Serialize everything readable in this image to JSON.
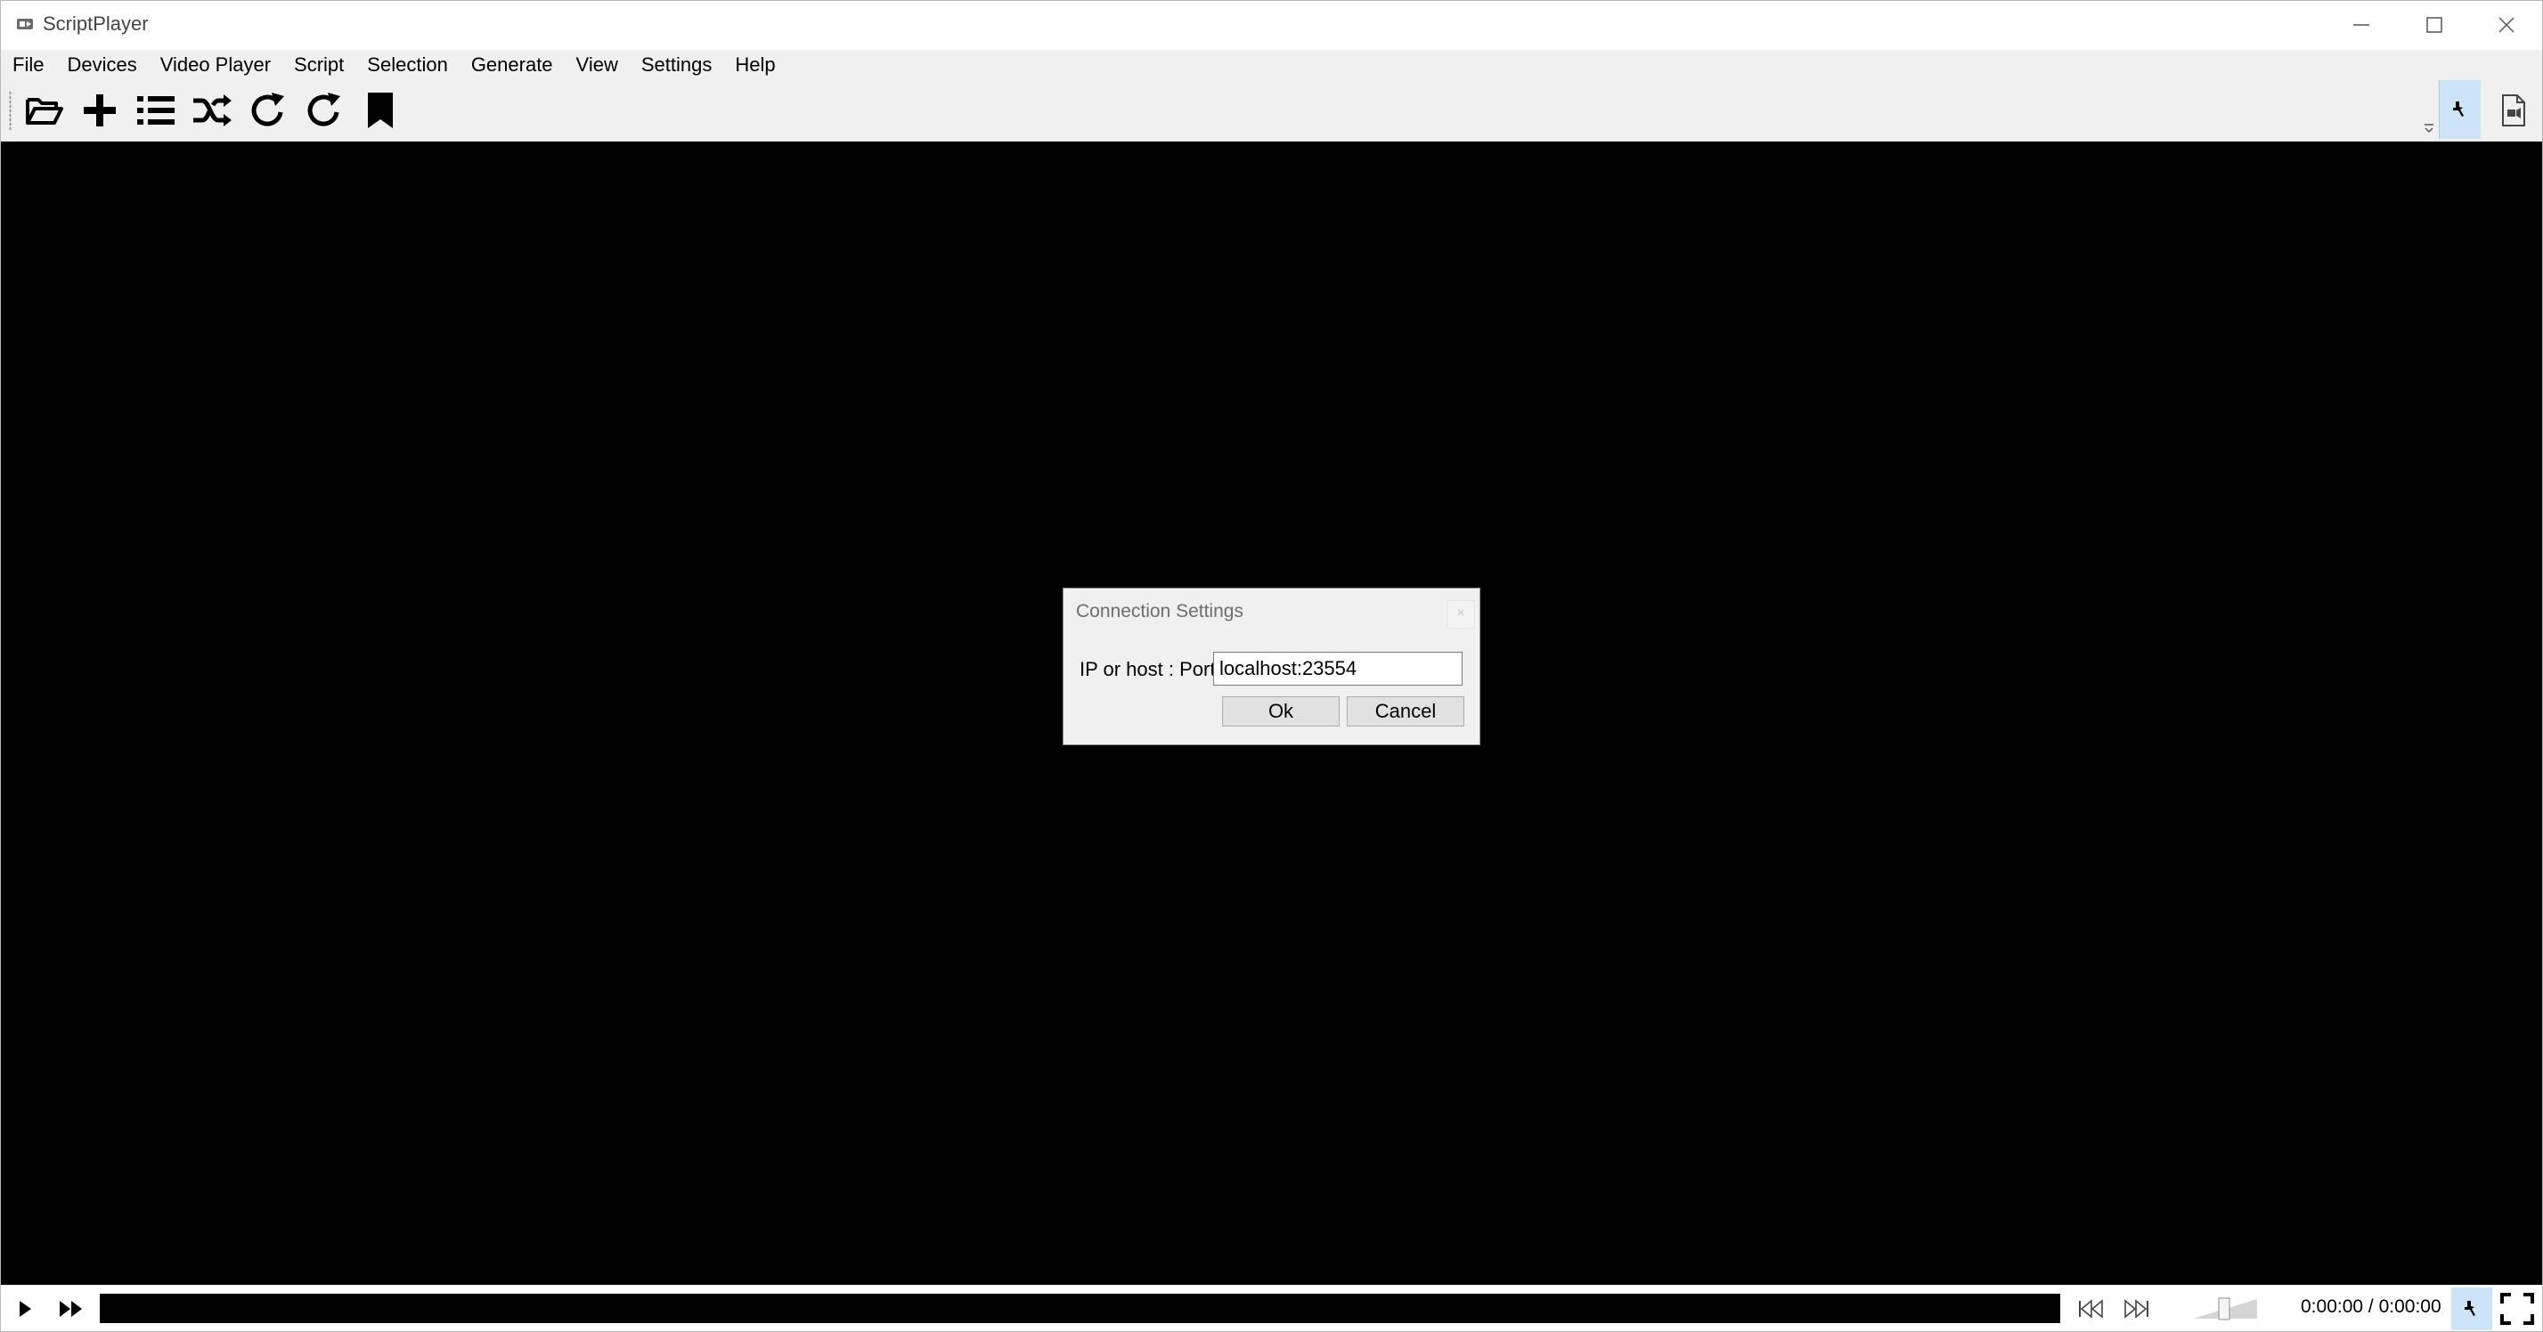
{
  "window": {
    "title": "ScriptPlayer"
  },
  "menu": {
    "items": [
      "File",
      "Devices",
      "Video Player",
      "Script",
      "Selection",
      "Generate",
      "View",
      "Settings",
      "Help"
    ]
  },
  "toolbar": {
    "icons": [
      "folder-open-icon",
      "add-icon",
      "playlist-icon",
      "shuffle-icon",
      "repeat-icon",
      "repeat-single-icon",
      "bookmark-icon"
    ],
    "right_icons": [
      "connect-plug-icon",
      "file-icon"
    ]
  },
  "dialog": {
    "title": "Connection Settings",
    "close_glyph": "×",
    "label": "IP or host : Port",
    "input_value": "localhost:23554",
    "ok_label": "Ok",
    "cancel_label": "Cancel"
  },
  "player": {
    "time": "0:00:00 / 0:00:00",
    "icons": [
      "play-icon",
      "fast-forward-icon",
      "skip-previous-icon",
      "skip-next-icon",
      "volume-slider",
      "connect-plug-icon",
      "fullscreen-icon"
    ]
  },
  "colors": {
    "chrome": "#f0f0f0",
    "video_background": "#000000",
    "active_toggle": "#cde4f7"
  }
}
